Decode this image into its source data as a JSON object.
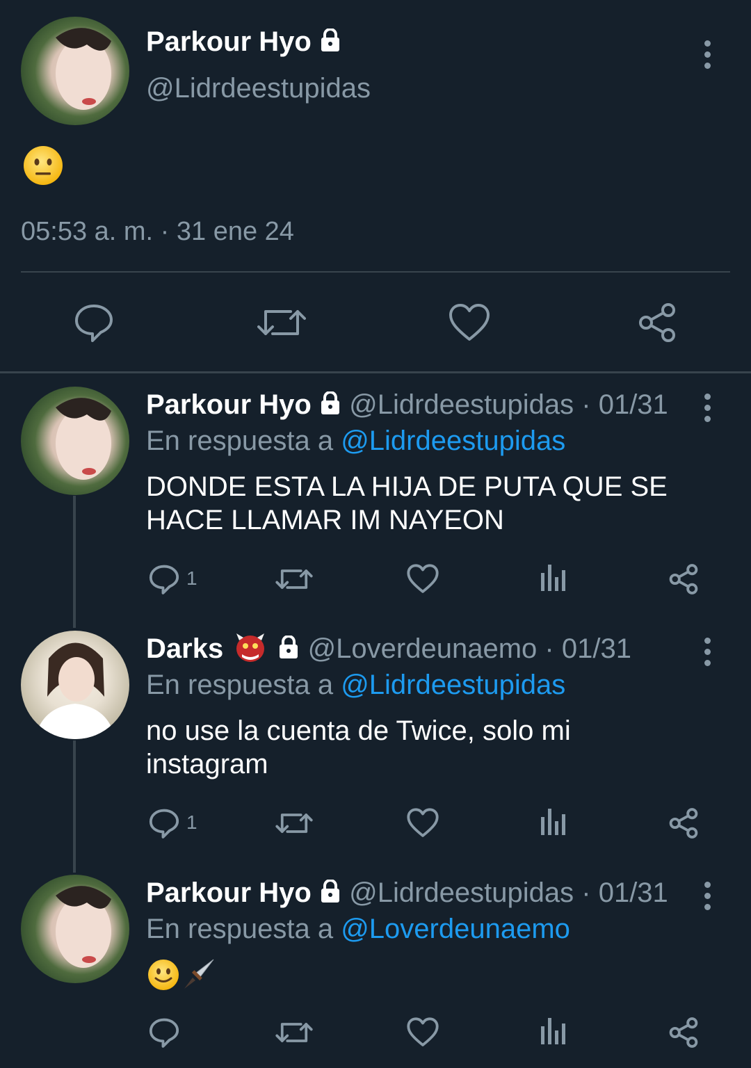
{
  "main_tweet": {
    "display_name": "Parkour Hyo",
    "handle": "@Lidrdeestupidas",
    "timestamp": "05:53 a. m. · 31 ene 24",
    "body_emoji": "neutral-face"
  },
  "replies": [
    {
      "display_name": "Parkour Hyo",
      "handle": "@Lidrdeestupidas",
      "date": "· 01/31",
      "reply_prefix": "En respuesta a",
      "reply_to": "@Lidrdeestupidas",
      "text_line1": "DONDE ESTA LA HIJA DE PUTA QUE SE",
      "text_line2": "HACE LLAMAR IM NAYEON",
      "reply_count": "1"
    },
    {
      "display_name": "Darks",
      "handle": "@Loverdeunaemo",
      "date": "· 01/31",
      "reply_prefix": "En respuesta a",
      "reply_to": "@Lidrdeestupidas",
      "text_line1": "no use la cuenta de Twice, solo mi",
      "text_line2": "instagram",
      "reply_count": "1"
    },
    {
      "display_name": "Parkour Hyo",
      "handle": "@Lidrdeestupidas",
      "date": "· 01/31",
      "reply_prefix": "En respuesta a",
      "reply_to": "@Loverdeunaemo",
      "body_emoji": "slightly-smiling-face dagger"
    }
  ],
  "colors": {
    "background": "#15202b",
    "muted": "#8899a6",
    "link": "#1d9bf0",
    "divider": "#38444d"
  }
}
